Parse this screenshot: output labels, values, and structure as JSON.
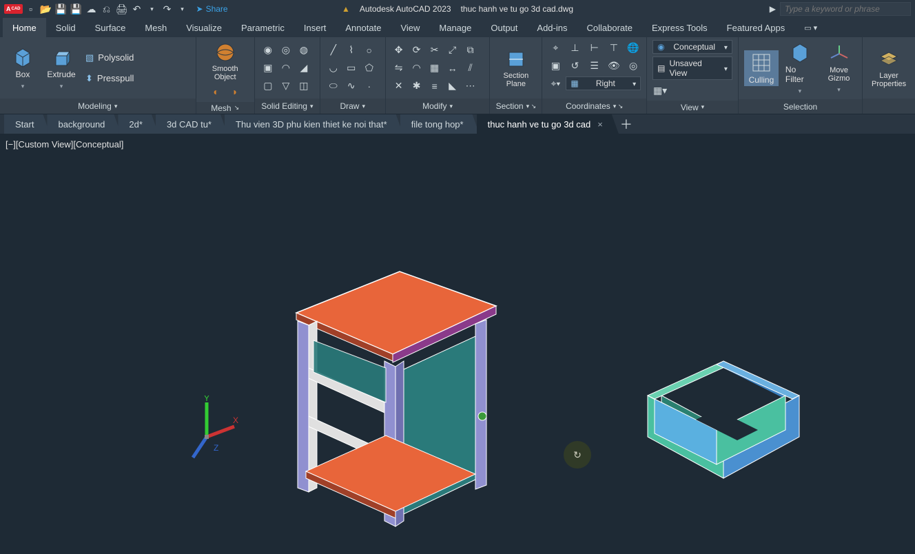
{
  "app": {
    "vendor": "Autodesk AutoCAD 2023",
    "document": "thuc hanh ve tu go 3d cad.dwg",
    "badge": "A",
    "badge_sub": "CAD"
  },
  "titlebar": {
    "share": "Share",
    "search_placeholder": "Type a keyword or phrase"
  },
  "ribbon_tabs": [
    "Home",
    "Solid",
    "Surface",
    "Mesh",
    "Visualize",
    "Parametric",
    "Insert",
    "Annotate",
    "View",
    "Manage",
    "Output",
    "Add-ins",
    "Collaborate",
    "Express Tools",
    "Featured Apps"
  ],
  "active_ribbon_tab": "Home",
  "panels": {
    "modeling": {
      "label": "Modeling",
      "box": "Box",
      "extrude": "Extrude",
      "polysolid": "Polysolid",
      "presspull": "Presspull"
    },
    "mesh": {
      "label": "Mesh",
      "smooth": "Smooth Object"
    },
    "solid_editing": {
      "label": "Solid Editing"
    },
    "draw": {
      "label": "Draw"
    },
    "modify": {
      "label": "Modify"
    },
    "section": {
      "label": "Section",
      "plane": "Section Plane"
    },
    "coordinates": {
      "label": "Coordinates",
      "nav": "Right"
    },
    "view": {
      "label": "View",
      "visual_style": "Conceptual",
      "saved_view": "Unsaved View"
    },
    "selection": {
      "label": "Selection",
      "culling": "Culling",
      "nofilter": "No Filter",
      "gizmo": "Move Gizmo"
    },
    "layers": {
      "label": "Layer Properties"
    }
  },
  "file_tabs": [
    "Start",
    "background",
    "2d*",
    "3d CAD tu*",
    "Thu vien 3D phu kien thiet ke noi that*",
    "file tong hop*",
    "thuc hanh ve tu go 3d cad"
  ],
  "active_file_tab": 6,
  "viewport": {
    "label": "[−][Custom View][Conceptual]"
  }
}
